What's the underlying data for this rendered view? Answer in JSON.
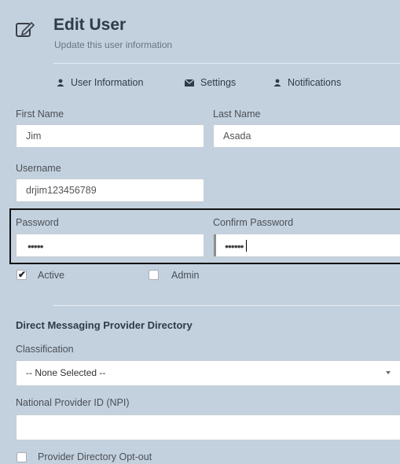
{
  "header": {
    "title": "Edit User",
    "subtitle": "Update this user information",
    "icon": "edit-icon"
  },
  "tabs": [
    {
      "label": "User Information",
      "icon": "user-icon"
    },
    {
      "label": "Settings",
      "icon": "envelope-icon"
    },
    {
      "label": "Notifications",
      "icon": "user-icon"
    }
  ],
  "form": {
    "first_name_label": "First Name",
    "first_name_value": "Jim",
    "last_name_label": "Last Name",
    "last_name_value": "Asada",
    "username_label": "Username",
    "username_value": "drjim123456789",
    "password_label": "Password",
    "password_mask": "•••••",
    "confirm_password_label": "Confirm Password",
    "confirm_password_mask": "••••••",
    "active_label": "Active",
    "active_checked": true,
    "admin_label": "Admin",
    "admin_checked": false
  },
  "directory": {
    "section_title": "Direct Messaging Provider Directory",
    "classification_label": "Classification",
    "classification_value": "-- None Selected --",
    "npi_label": "National Provider ID (NPI)",
    "npi_value": "",
    "opt_out_label": "Provider Directory Opt-out",
    "opt_out_checked": false
  }
}
